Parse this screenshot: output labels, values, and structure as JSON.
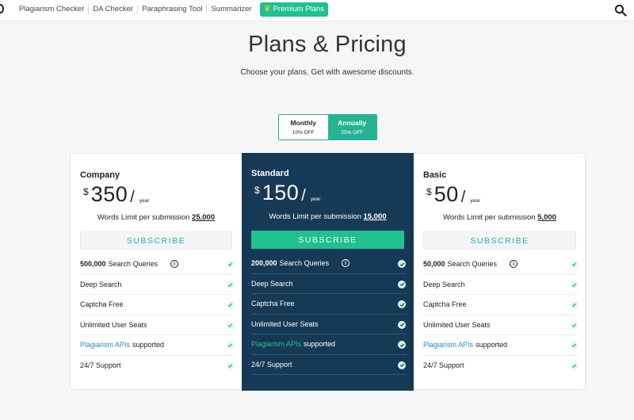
{
  "nav": {
    "links": [
      "Plagiarism Checker",
      "DA Checker",
      "Paraphrasing Tool",
      "Summarizer"
    ],
    "premium_label": "Premium Plans"
  },
  "hero": {
    "title": "Plans & Pricing",
    "subtitle": "Choose your plans. Get with awesome discounts."
  },
  "toggle": {
    "monthly": {
      "label": "Monthly",
      "discount": "10% OFF"
    },
    "annually": {
      "label": "Annually",
      "discount": "25% OFF"
    },
    "selected": "annually"
  },
  "plans": [
    {
      "name": "Company",
      "currency": "$",
      "amount": "350",
      "slash": "/",
      "per": "year",
      "limit_text": "Words Limit per submission",
      "limit_value": "25,000",
      "button": "SUBSCRIBE",
      "features": {
        "queries_bold": "500,000",
        "queries_text": "Search Queries",
        "deep": "Deep Search",
        "captcha": "Captcha Free",
        "seats": "Unlimited User Seats",
        "api_link": "Plagiarism APIs",
        "api_text": "supported",
        "support": "24/7 Support"
      }
    },
    {
      "name": "Standard",
      "currency": "$",
      "amount": "150",
      "slash": "/",
      "per": "year",
      "limit_text": "Words Limit per submission",
      "limit_value": "15,000",
      "button": "SUBSCRIBE",
      "features": {
        "queries_bold": "200,000",
        "queries_text": "Search Queries",
        "deep": "Deep Search",
        "captcha": "Captcha Free",
        "seats": "Unlimited User Seats",
        "api_link": "Plagiarism APIs",
        "api_text": "supported",
        "support": "24/7 Support"
      }
    },
    {
      "name": "Basic",
      "currency": "$",
      "amount": "50",
      "slash": "/",
      "per": "year",
      "limit_text": "Words Limit per submission",
      "limit_value": "5,000",
      "button": "SUBSCRIBE",
      "features": {
        "queries_bold": "50,000",
        "queries_text": "Search Queries",
        "deep": "Deep Search",
        "captcha": "Captcha Free",
        "seats": "Unlimited User Seats",
        "api_link": "Plagiarism APIs",
        "api_text": "supported",
        "support": "24/7 Support"
      }
    }
  ],
  "colors": {
    "accent": "#20c08f",
    "toggle_active": "#26b394",
    "featured_bg": "#163a56",
    "link": "#1e8cc8"
  },
  "icons": {
    "search": "search-icon",
    "crown": "crown-icon",
    "check": "check-icon",
    "info": "info-icon"
  }
}
